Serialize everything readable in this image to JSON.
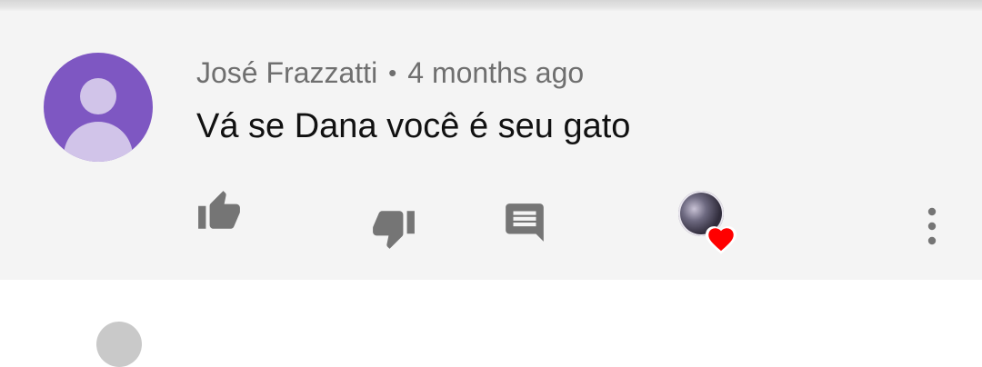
{
  "comment": {
    "author": "José Frazzatti",
    "separator": "•",
    "time_ago": "4 months ago",
    "text": "Vá se Dana você é seu gato"
  },
  "icons": {
    "like": "thumb-up-icon",
    "dislike": "thumb-down-icon",
    "reply": "comment-icon",
    "creator_heart": "creator-heart-icon",
    "more": "more-vertical-icon"
  },
  "colors": {
    "card_background": "#f4f4f4",
    "avatar_background": "#7e57c2",
    "avatar_figure": "#d1c4e9",
    "icon_gray": "#757575",
    "heart_red": "#ff0000"
  }
}
